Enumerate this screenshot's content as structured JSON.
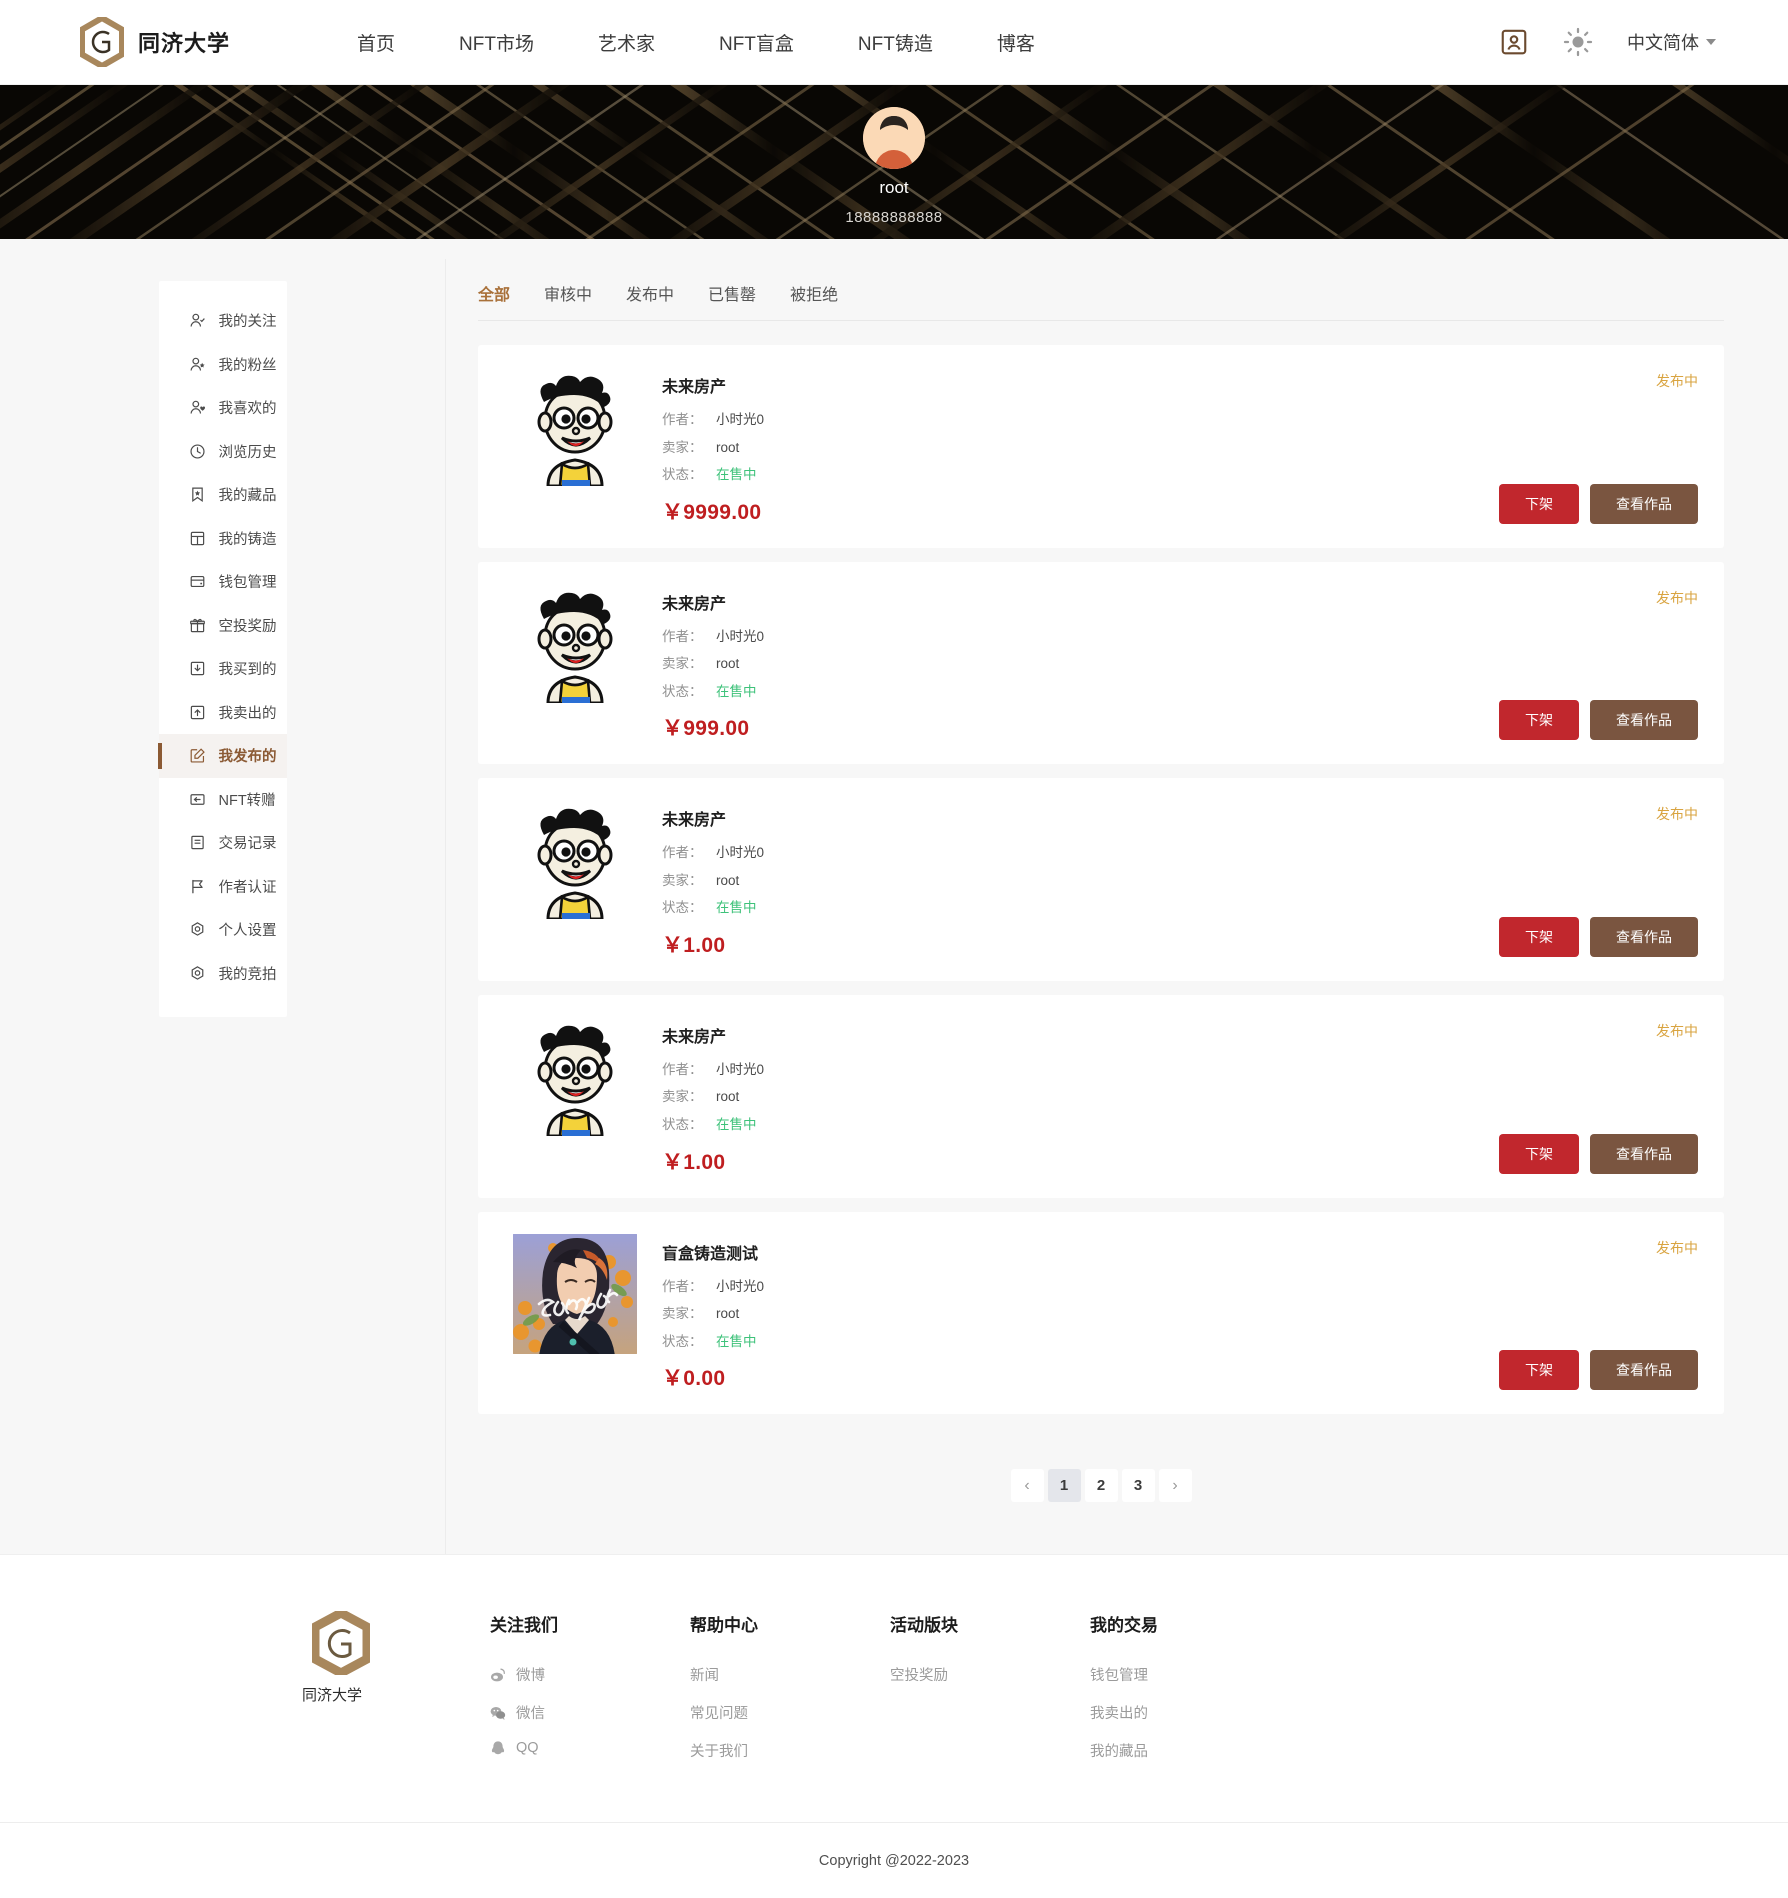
{
  "header": {
    "brand": "同济大学",
    "nav": [
      {
        "label": "首页"
      },
      {
        "label": "NFT市场"
      },
      {
        "label": "艺术家"
      },
      {
        "label": "NFT盲盒"
      },
      {
        "label": "NFT铸造"
      },
      {
        "label": "博客"
      }
    ],
    "profile_icon": "user-card-icon",
    "theme_icon": "sun-icon",
    "language": "中文简体"
  },
  "banner": {
    "avatar_icon": "user-avatar",
    "username": "root",
    "phone": "18888888888"
  },
  "sidebar": {
    "items": [
      {
        "label": "我的关注",
        "icon": "user-check-icon",
        "active": false
      },
      {
        "label": "我的粉丝",
        "icon": "user-star-icon",
        "active": false
      },
      {
        "label": "我喜欢的",
        "icon": "user-heart-icon",
        "active": false
      },
      {
        "label": "浏览历史",
        "icon": "clock-icon",
        "active": false
      },
      {
        "label": "我的藏品",
        "icon": "bookmark-star-icon",
        "active": false
      },
      {
        "label": "我的铸造",
        "icon": "grid-icon",
        "active": false
      },
      {
        "label": "钱包管理",
        "icon": "wallet-icon",
        "active": false
      },
      {
        "label": "空投奖励",
        "icon": "gift-icon",
        "active": false
      },
      {
        "label": "我买到的",
        "icon": "box-down-icon",
        "active": false
      },
      {
        "label": "我卖出的",
        "icon": "box-up-icon",
        "active": false
      },
      {
        "label": "我发布的",
        "icon": "edit-square-icon",
        "active": true
      },
      {
        "label": "NFT转赠",
        "icon": "transfer-icon",
        "active": false
      },
      {
        "label": "交易记录",
        "icon": "list-icon",
        "active": false
      },
      {
        "label": "作者认证",
        "icon": "flag-icon",
        "active": false
      },
      {
        "label": "个人设置",
        "icon": "gear-icon",
        "active": false
      },
      {
        "label": "我的竞拍",
        "icon": "gear-icon",
        "active": false
      }
    ]
  },
  "tabs": [
    {
      "label": "全部",
      "active": true
    },
    {
      "label": "审核中",
      "active": false
    },
    {
      "label": "发布中",
      "active": false
    },
    {
      "label": "已售罄",
      "active": false
    },
    {
      "label": "被拒绝",
      "active": false
    }
  ],
  "labels": {
    "author": "作者：",
    "seller": "卖家：",
    "status": "状态："
  },
  "buttons": {
    "remove": "下架",
    "view": "查看作品"
  },
  "cards": [
    {
      "title": "未来房产",
      "author": "小时光0",
      "seller": "root",
      "status": "在售中",
      "price": "￥9999.00",
      "badge": "发布中",
      "thumb": "cartoon-boy"
    },
    {
      "title": "未来房产",
      "author": "小时光0",
      "seller": "root",
      "status": "在售中",
      "price": "￥999.00",
      "badge": "发布中",
      "thumb": "cartoon-boy"
    },
    {
      "title": "未来房产",
      "author": "小时光0",
      "seller": "root",
      "status": "在售中",
      "price": "￥1.00",
      "badge": "发布中",
      "thumb": "cartoon-boy"
    },
    {
      "title": "未来房产",
      "author": "小时光0",
      "seller": "root",
      "status": "在售中",
      "price": "￥1.00",
      "badge": "发布中",
      "thumb": "cartoon-boy"
    },
    {
      "title": "盲盒铸造测试",
      "author": "小时光0",
      "seller": "root",
      "status": "在售中",
      "price": "￥0.00",
      "badge": "发布中",
      "thumb": "anime-sample"
    }
  ],
  "pagination": {
    "prev": "‹",
    "pages": [
      {
        "label": "1",
        "active": true
      },
      {
        "label": "2",
        "active": false
      },
      {
        "label": "3",
        "active": false
      }
    ],
    "next": "›"
  },
  "footer": {
    "brand": "同济大学",
    "columns": [
      {
        "title": "关注我们",
        "links": [
          {
            "label": "微博",
            "icon": "weibo-icon"
          },
          {
            "label": "微信",
            "icon": "wechat-icon"
          },
          {
            "label": "QQ",
            "icon": "qq-icon"
          }
        ]
      },
      {
        "title": "帮助中心",
        "links": [
          {
            "label": "新闻",
            "icon": ""
          },
          {
            "label": "常见问题",
            "icon": ""
          },
          {
            "label": "关于我们",
            "icon": ""
          }
        ]
      },
      {
        "title": "活动版块",
        "links": [
          {
            "label": "空投奖励",
            "icon": ""
          }
        ]
      },
      {
        "title": "我的交易",
        "links": [
          {
            "label": "钱包管理",
            "icon": ""
          },
          {
            "label": "我卖出的",
            "icon": ""
          },
          {
            "label": "我的藏品",
            "icon": ""
          }
        ]
      }
    ],
    "copyright": "Copyright @2022-2023"
  },
  "colors": {
    "accent_brown": "#8b5a34",
    "accent_gold": "#b08d5e",
    "price_red": "#bf1e20",
    "status_green": "#3ec27a",
    "badge_orange": "#d9a441",
    "btn_remove": "#c1272d",
    "btn_view": "#7a5540"
  }
}
